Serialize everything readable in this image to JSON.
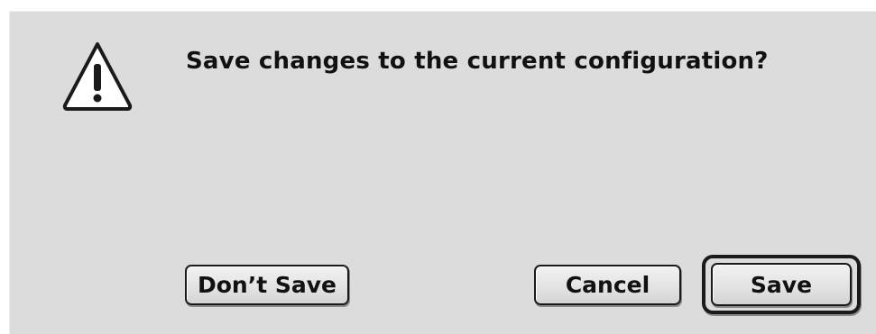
{
  "dialog": {
    "message": "Save changes to the current configuration?",
    "icon": "warning-icon"
  },
  "buttons": {
    "dont_save": "Don’t Save",
    "cancel": "Cancel",
    "save": "Save"
  },
  "colors": {
    "dialog_background": "#dcdcdc",
    "button_border": "#1a1a1a"
  }
}
